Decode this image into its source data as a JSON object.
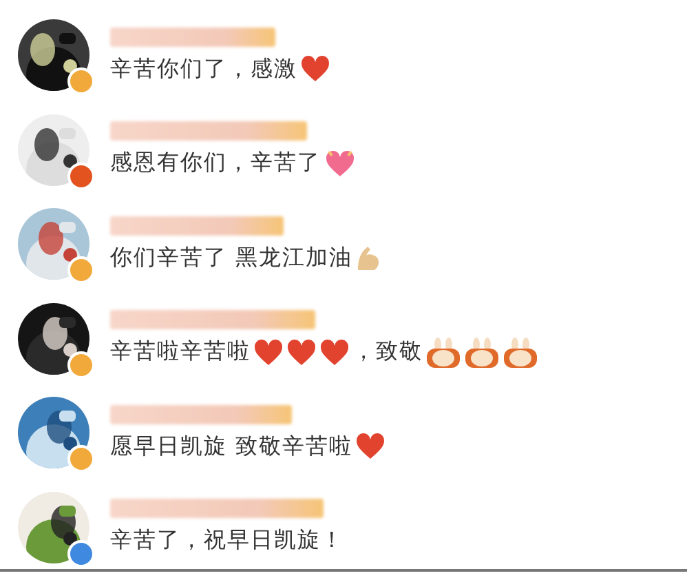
{
  "comments": [
    {
      "badge": {
        "color": "#f2a93b"
      },
      "avatar": {
        "kind": "picture"
      },
      "parts": [
        {
          "kind": "text",
          "text": "辛苦你们了，感激"
        },
        {
          "kind": "heart"
        }
      ]
    },
    {
      "badge": {
        "color": "#e2531f"
      },
      "avatar": {
        "kind": "picture"
      },
      "parts": [
        {
          "kind": "text",
          "text": "感恩有你们，辛苦了"
        },
        {
          "kind": "pink-heart"
        }
      ]
    },
    {
      "badge": {
        "color": "#f2a93b"
      },
      "avatar": {
        "kind": "picture"
      },
      "parts": [
        {
          "kind": "text",
          "text": "你们辛苦了 黑龙江加油"
        },
        {
          "kind": "arm"
        }
      ]
    },
    {
      "badge": {
        "color": "#f2a93b"
      },
      "avatar": {
        "kind": "picture"
      },
      "parts": [
        {
          "kind": "text",
          "text": "辛苦啦辛苦啦"
        },
        {
          "kind": "heart"
        },
        {
          "kind": "heart"
        },
        {
          "kind": "heart"
        },
        {
          "kind": "text",
          "text": "，致敬"
        },
        {
          "kind": "bunny"
        },
        {
          "kind": "bunny"
        },
        {
          "kind": "bunny"
        }
      ]
    },
    {
      "badge": {
        "color": "#f2a93b"
      },
      "avatar": {
        "kind": "picture"
      },
      "parts": [
        {
          "kind": "text",
          "text": "愿早日凯旋 致敬辛苦啦"
        },
        {
          "kind": "heart"
        }
      ]
    },
    {
      "badge": {
        "color": "#3f8ae0"
      },
      "avatar": {
        "kind": "picture"
      },
      "parts": [
        {
          "kind": "text",
          "text": "辛苦了，祝早日凯旋！"
        }
      ]
    }
  ]
}
